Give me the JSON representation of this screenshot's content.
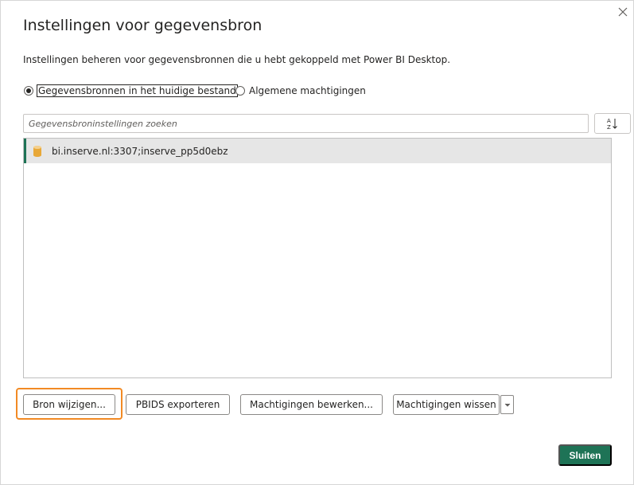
{
  "dialog": {
    "title": "Instellingen voor gegevensbron",
    "description": "Instellingen beheren voor gegevensbronnen die u hebt gekoppeld met Power BI Desktop."
  },
  "scope": {
    "options": [
      {
        "label": "Gegevensbronnen in het huidige bestand",
        "selected": true
      },
      {
        "label": "Algemene machtigingen",
        "selected": false
      }
    ]
  },
  "search": {
    "placeholder": "Gegevensbroninstellingen zoeken",
    "value": ""
  },
  "sort": {
    "icon": "sort-az-icon"
  },
  "sources": [
    {
      "label": "bi.inserve.nl:3307;inserve_pp5d0ebz",
      "icon": "database-icon",
      "selected": true
    }
  ],
  "buttons": {
    "change_source": "Bron wijzigen...",
    "export_pbids": "PBIDS exporteren",
    "edit_permissions": "Machtigingen bewerken...",
    "clear_permissions": "Machtigingen wissen",
    "close": "Sluiten"
  },
  "colors": {
    "accent": "#1e7356",
    "highlight": "#f28a24",
    "selection": "#e6e6e6"
  }
}
